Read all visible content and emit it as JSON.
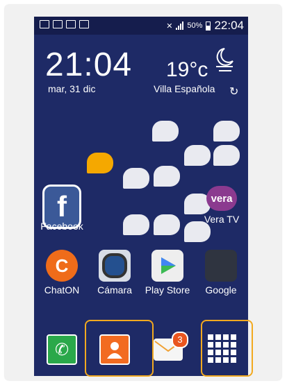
{
  "status_bar": {
    "battery": "50%",
    "time": "22:04"
  },
  "clock_widget": {
    "time": "21:04",
    "date": "mar, 31 dic",
    "temperature": "19°c",
    "location": "Villa Española"
  },
  "apps": [
    {
      "label": "Facebook",
      "icon": "facebook-icon",
      "color": "#3b5998"
    },
    {
      "label": "Vera TV",
      "icon": "vera-tv-icon",
      "color": "#8b3a8f"
    },
    {
      "label": "ChatON",
      "icon": "chaton-icon",
      "color": "#ef6c1a"
    },
    {
      "label": "Cámara",
      "icon": "camera-icon",
      "color": "#3b7fc4"
    },
    {
      "label": "Play Store",
      "icon": "play-store-icon",
      "color": "#ffffff"
    },
    {
      "label": "Google",
      "icon": "google-folder-icon",
      "color": "#4285f4"
    }
  ],
  "dock": {
    "email_badge": "3",
    "items": [
      "phone-icon",
      "contacts-icon",
      "email-icon",
      "apps-grid-icon"
    ]
  },
  "colors": {
    "wallpaper": "#1e2a66",
    "highlight": "#f2a91f",
    "phone": "#2aa84a",
    "contacts": "#f26b21"
  }
}
